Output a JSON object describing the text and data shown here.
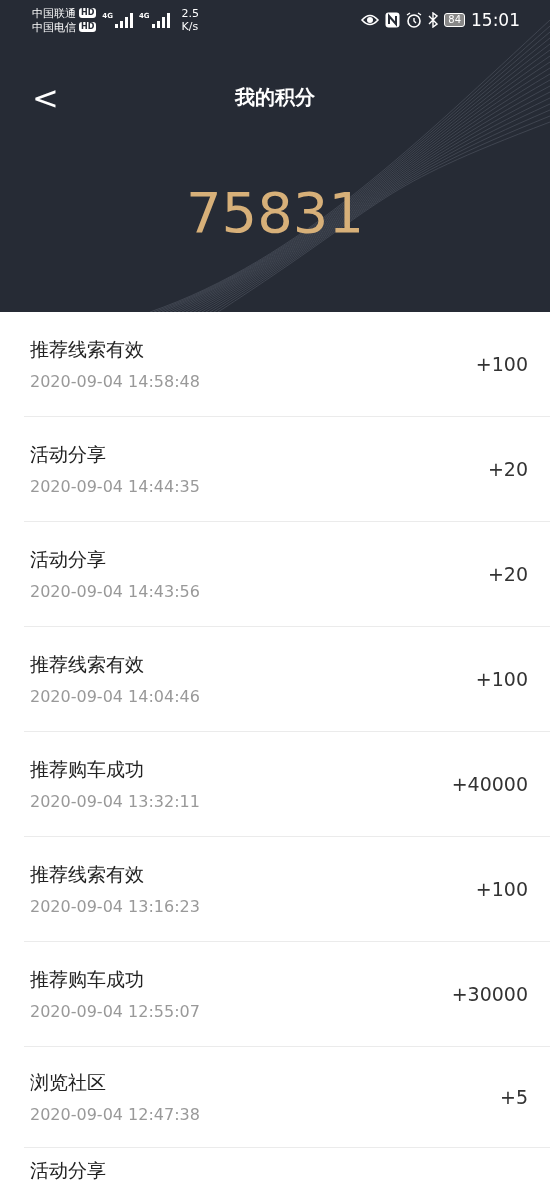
{
  "status_bar": {
    "carriers": [
      {
        "name": "中国联通",
        "badge": "HD",
        "network": "4G"
      },
      {
        "name": "中国电信",
        "badge": "HD",
        "network": "4G"
      }
    ],
    "speed_value": "2.5",
    "speed_unit": "K/s",
    "battery": "84",
    "time": "15:01"
  },
  "header": {
    "back": "<",
    "title": "我的积分",
    "points": "75831"
  },
  "records": [
    {
      "title": "推荐线索有效",
      "time": "2020-09-04 14:58:48",
      "points": "+100"
    },
    {
      "title": "活动分享",
      "time": "2020-09-04 14:44:35",
      "points": "+20"
    },
    {
      "title": "活动分享",
      "time": "2020-09-04 14:43:56",
      "points": "+20"
    },
    {
      "title": "推荐线索有效",
      "time": "2020-09-04 14:04:46",
      "points": "+100"
    },
    {
      "title": "推荐购车成功",
      "time": "2020-09-04 13:32:11",
      "points": "+40000"
    },
    {
      "title": "推荐线索有效",
      "time": "2020-09-04 13:16:23",
      "points": "+100"
    },
    {
      "title": "推荐购车成功",
      "time": "2020-09-04 12:55:07",
      "points": "+30000"
    },
    {
      "title": "浏览社区",
      "time": "2020-09-04 12:47:38",
      "points": "+5"
    },
    {
      "title": "活动分享"
    }
  ]
}
